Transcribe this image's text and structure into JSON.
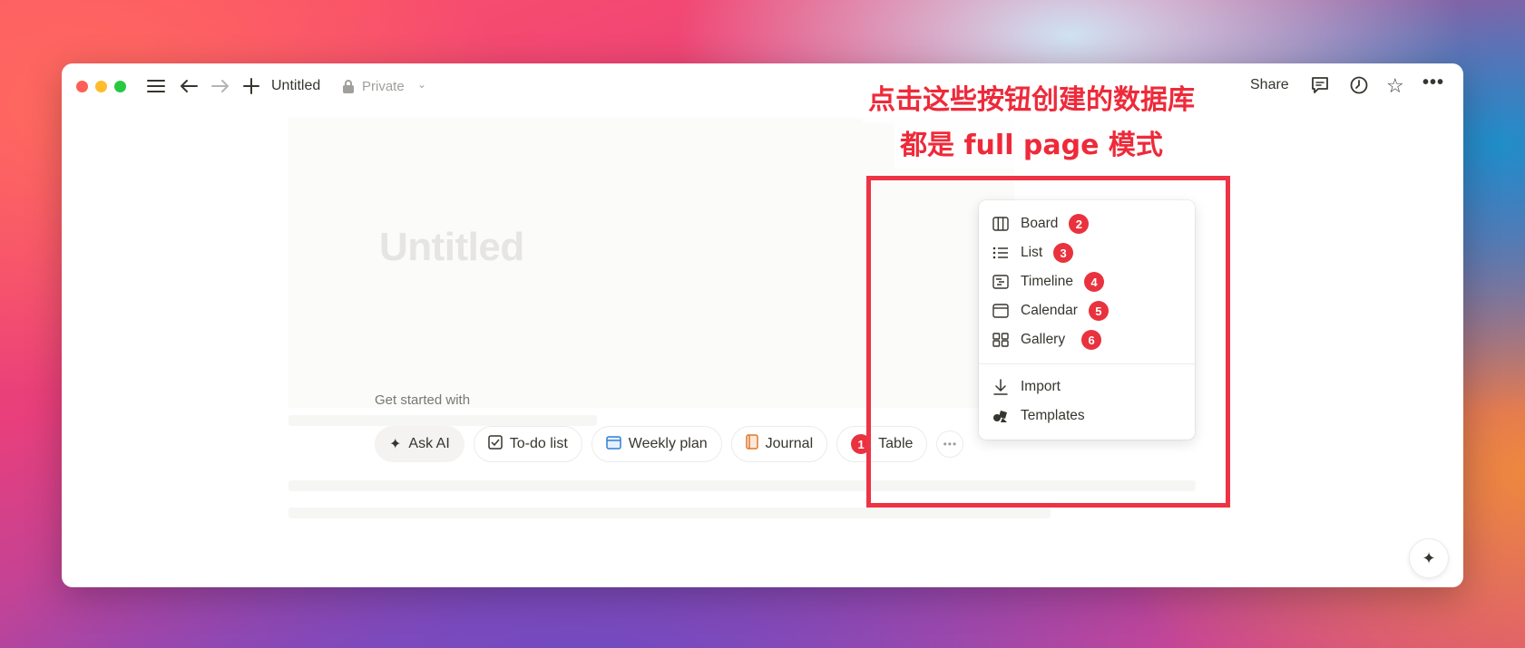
{
  "topbar": {
    "page_name": "Untitled",
    "privacy_label": "Private",
    "share_label": "Share"
  },
  "page": {
    "title_placeholder": "Untitled",
    "get_started_label": "Get started with",
    "chips": [
      {
        "label": "Ask AI",
        "icon": "sparkle-icon"
      },
      {
        "label": "To-do list",
        "icon": "checkbox-icon"
      },
      {
        "label": "Weekly plan",
        "icon": "calendar-icon"
      },
      {
        "label": "Journal",
        "icon": "book-icon"
      },
      {
        "label": "Table",
        "icon": "table-icon",
        "badge": "1"
      }
    ]
  },
  "dropdown": {
    "items": [
      {
        "label": "Board",
        "icon": "board-icon",
        "badge": "2"
      },
      {
        "label": "List",
        "icon": "list-icon",
        "badge": "3"
      },
      {
        "label": "Timeline",
        "icon": "timeline-icon",
        "badge": "4"
      },
      {
        "label": "Calendar",
        "icon": "calendar-icon",
        "badge": "5"
      },
      {
        "label": "Gallery",
        "icon": "gallery-icon",
        "badge": "6"
      },
      {
        "label": "Import",
        "icon": "import-icon"
      },
      {
        "label": "Templates",
        "icon": "templates-icon"
      }
    ]
  },
  "annotation": {
    "line1": "点击这些按钮创建的数据库",
    "line2": "都是 full page 模式"
  },
  "colors": {
    "annotation": "#ee2a3a",
    "badge": "#e9323e",
    "text": "#37352f"
  }
}
